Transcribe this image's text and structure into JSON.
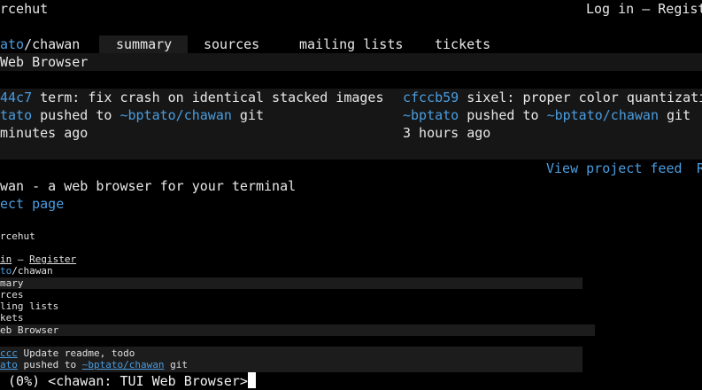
{
  "header": {
    "brand": "rcehut",
    "login": "Log in",
    "separator": " — ",
    "register": "Regist"
  },
  "nav": {
    "owner": "ato",
    "slash": "/",
    "repo": "chawan",
    "tabs": [
      {
        "label": "summary",
        "active": true
      },
      {
        "label": "sources",
        "active": false
      },
      {
        "label": "mailing lists",
        "active": false
      },
      {
        "label": "tickets",
        "active": false
      }
    ]
  },
  "description": "Web Browser",
  "events": [
    {
      "hash": "44c7",
      "message": " term: fix crash on identical stacked images",
      "user": "tato",
      "action": " pushed to ",
      "target": "~bptato/chawan",
      "kind": " git",
      "time": "minutes ago"
    },
    {
      "hash": "cfccb59",
      "message": " sixel: proper color quantizati",
      "user": "~bptato",
      "action": " pushed to ",
      "target": "~bptato/chawan",
      "kind": " git",
      "time": "3 hours ago"
    }
  ],
  "feed": {
    "view_feed": "View project feed",
    "extra": "R"
  },
  "readme": {
    "tagline": "wan - a web browser for your terminal",
    "project_page": "ect page"
  },
  "preview": {
    "brand": "rcehut",
    "login": "in",
    "separator": " — ",
    "register": "Register",
    "owner": "to",
    "repo": "/chawan",
    "tabs": [
      "mary",
      "rces",
      "ling lists",
      "kets"
    ],
    "description": "eb Browser",
    "commit_hash": "ccc",
    "commit_msg": " Update readme, todo",
    "user": "ato",
    "action": " pushed to ",
    "target": "~bptato/chawan",
    "kind": " git"
  },
  "status": {
    "text": " (0%) <chawan: TUI Web Browser>"
  }
}
